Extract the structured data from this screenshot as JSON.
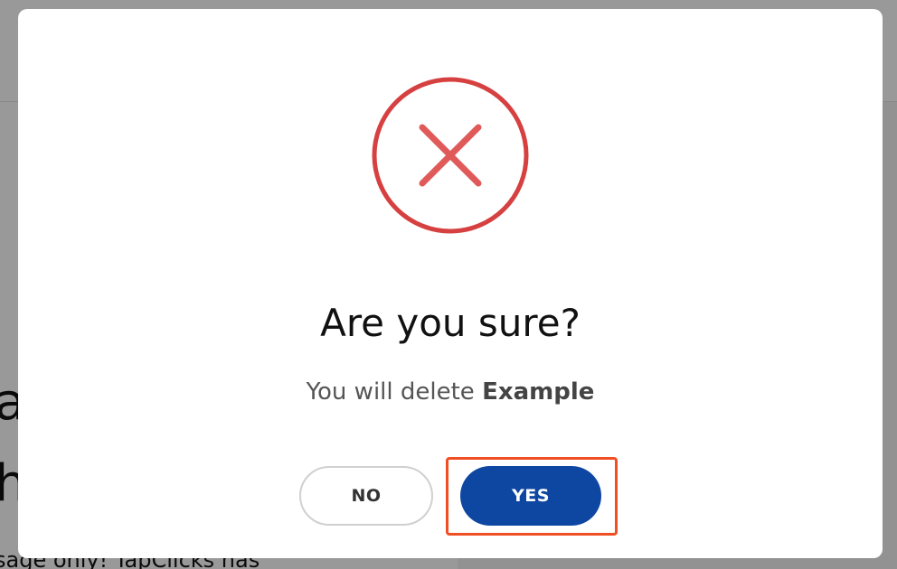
{
  "background": {
    "heading_line_1": "ap",
    "heading_line_2": "h",
    "body_text": "sage only! TapClicks has"
  },
  "dialog": {
    "icon": "close-icon",
    "title": "Are you sure?",
    "message_prefix": "You will delete ",
    "message_target": "Example",
    "no_label": "NO",
    "yes_label": "YES"
  },
  "colors": {
    "icon_red": "#d64040",
    "yes_button": "#0d47a1",
    "highlight": "#f04e23"
  }
}
